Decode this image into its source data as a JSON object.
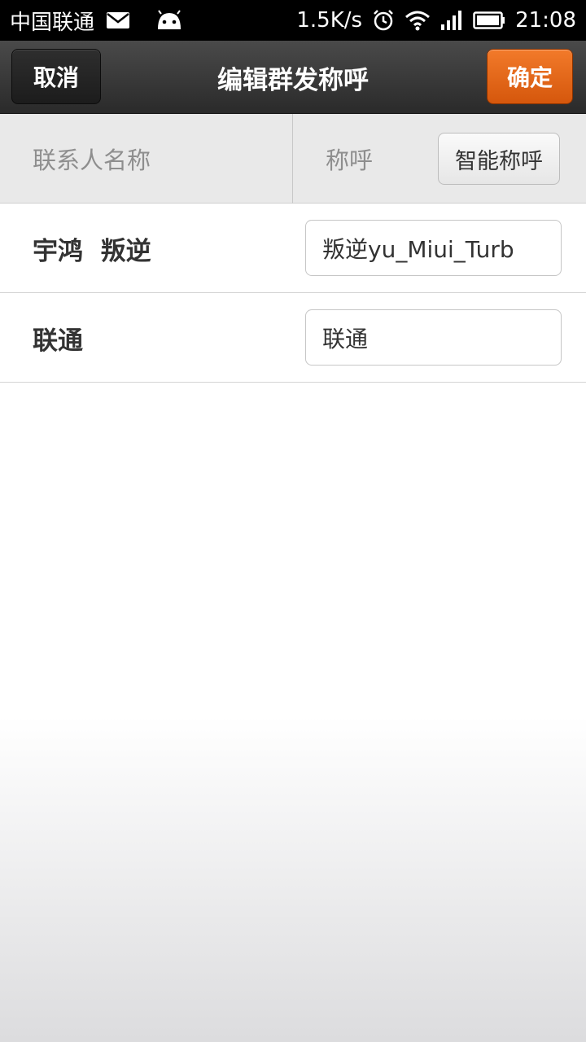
{
  "status_bar": {
    "carrier": "中国联通",
    "network_speed": "1.5K/s",
    "time": "21:08",
    "icons": [
      "mail-icon",
      "android-icon",
      "alarm-icon",
      "wifi-icon",
      "signal-icon",
      "battery-icon"
    ]
  },
  "title_bar": {
    "cancel_label": "取消",
    "title": "编辑群发称呼",
    "confirm_label": "确定"
  },
  "column_header": {
    "name_label": "联系人名称",
    "salutation_label": "称呼",
    "smart_button_label": "智能称呼"
  },
  "rows": [
    {
      "name": "宇鸿  叛逆",
      "salutation": "叛逆yu_Miui_Turb"
    },
    {
      "name": "联通",
      "salutation": "联通"
    }
  ],
  "colors": {
    "status_bar_bg": "#000000",
    "title_bar_bg": "#3a3a3a",
    "confirm_accent": "#e86a1c",
    "header_bg": "#e9e9e9"
  }
}
